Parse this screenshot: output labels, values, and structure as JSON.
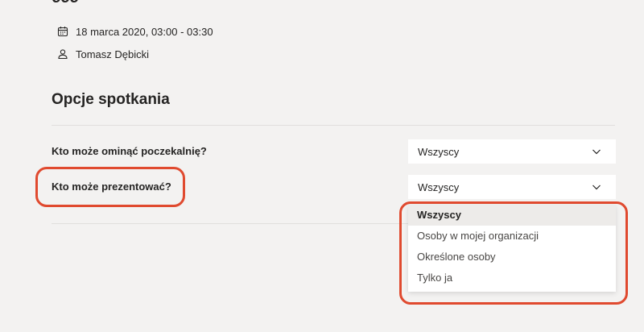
{
  "meeting": {
    "title": "ccc",
    "date": "18 marca 2020, 03:00 - 03:30",
    "organizer": "Tomasz Dębicki",
    "date_icon": "calendar-icon",
    "organizer_icon": "person-icon"
  },
  "options": {
    "section_title": "Opcje spotkania",
    "lobby_bypass": {
      "label": "Kto może ominąć poczekalnię?",
      "value": "Wszyscy"
    },
    "who_can_present": {
      "label": "Kto może prezentować?",
      "value": "Wszyscy",
      "menu_items": [
        "Wszyscy",
        "Osoby w mojej organizacji",
        "Określone osoby",
        "Tylko ja"
      ],
      "selected_index": 0
    }
  },
  "colors": {
    "background": "#f3f2f1",
    "highlight": "#e04a2f",
    "dropdown_bg": "#ffffff",
    "selected_item_bg": "#edebe9"
  }
}
